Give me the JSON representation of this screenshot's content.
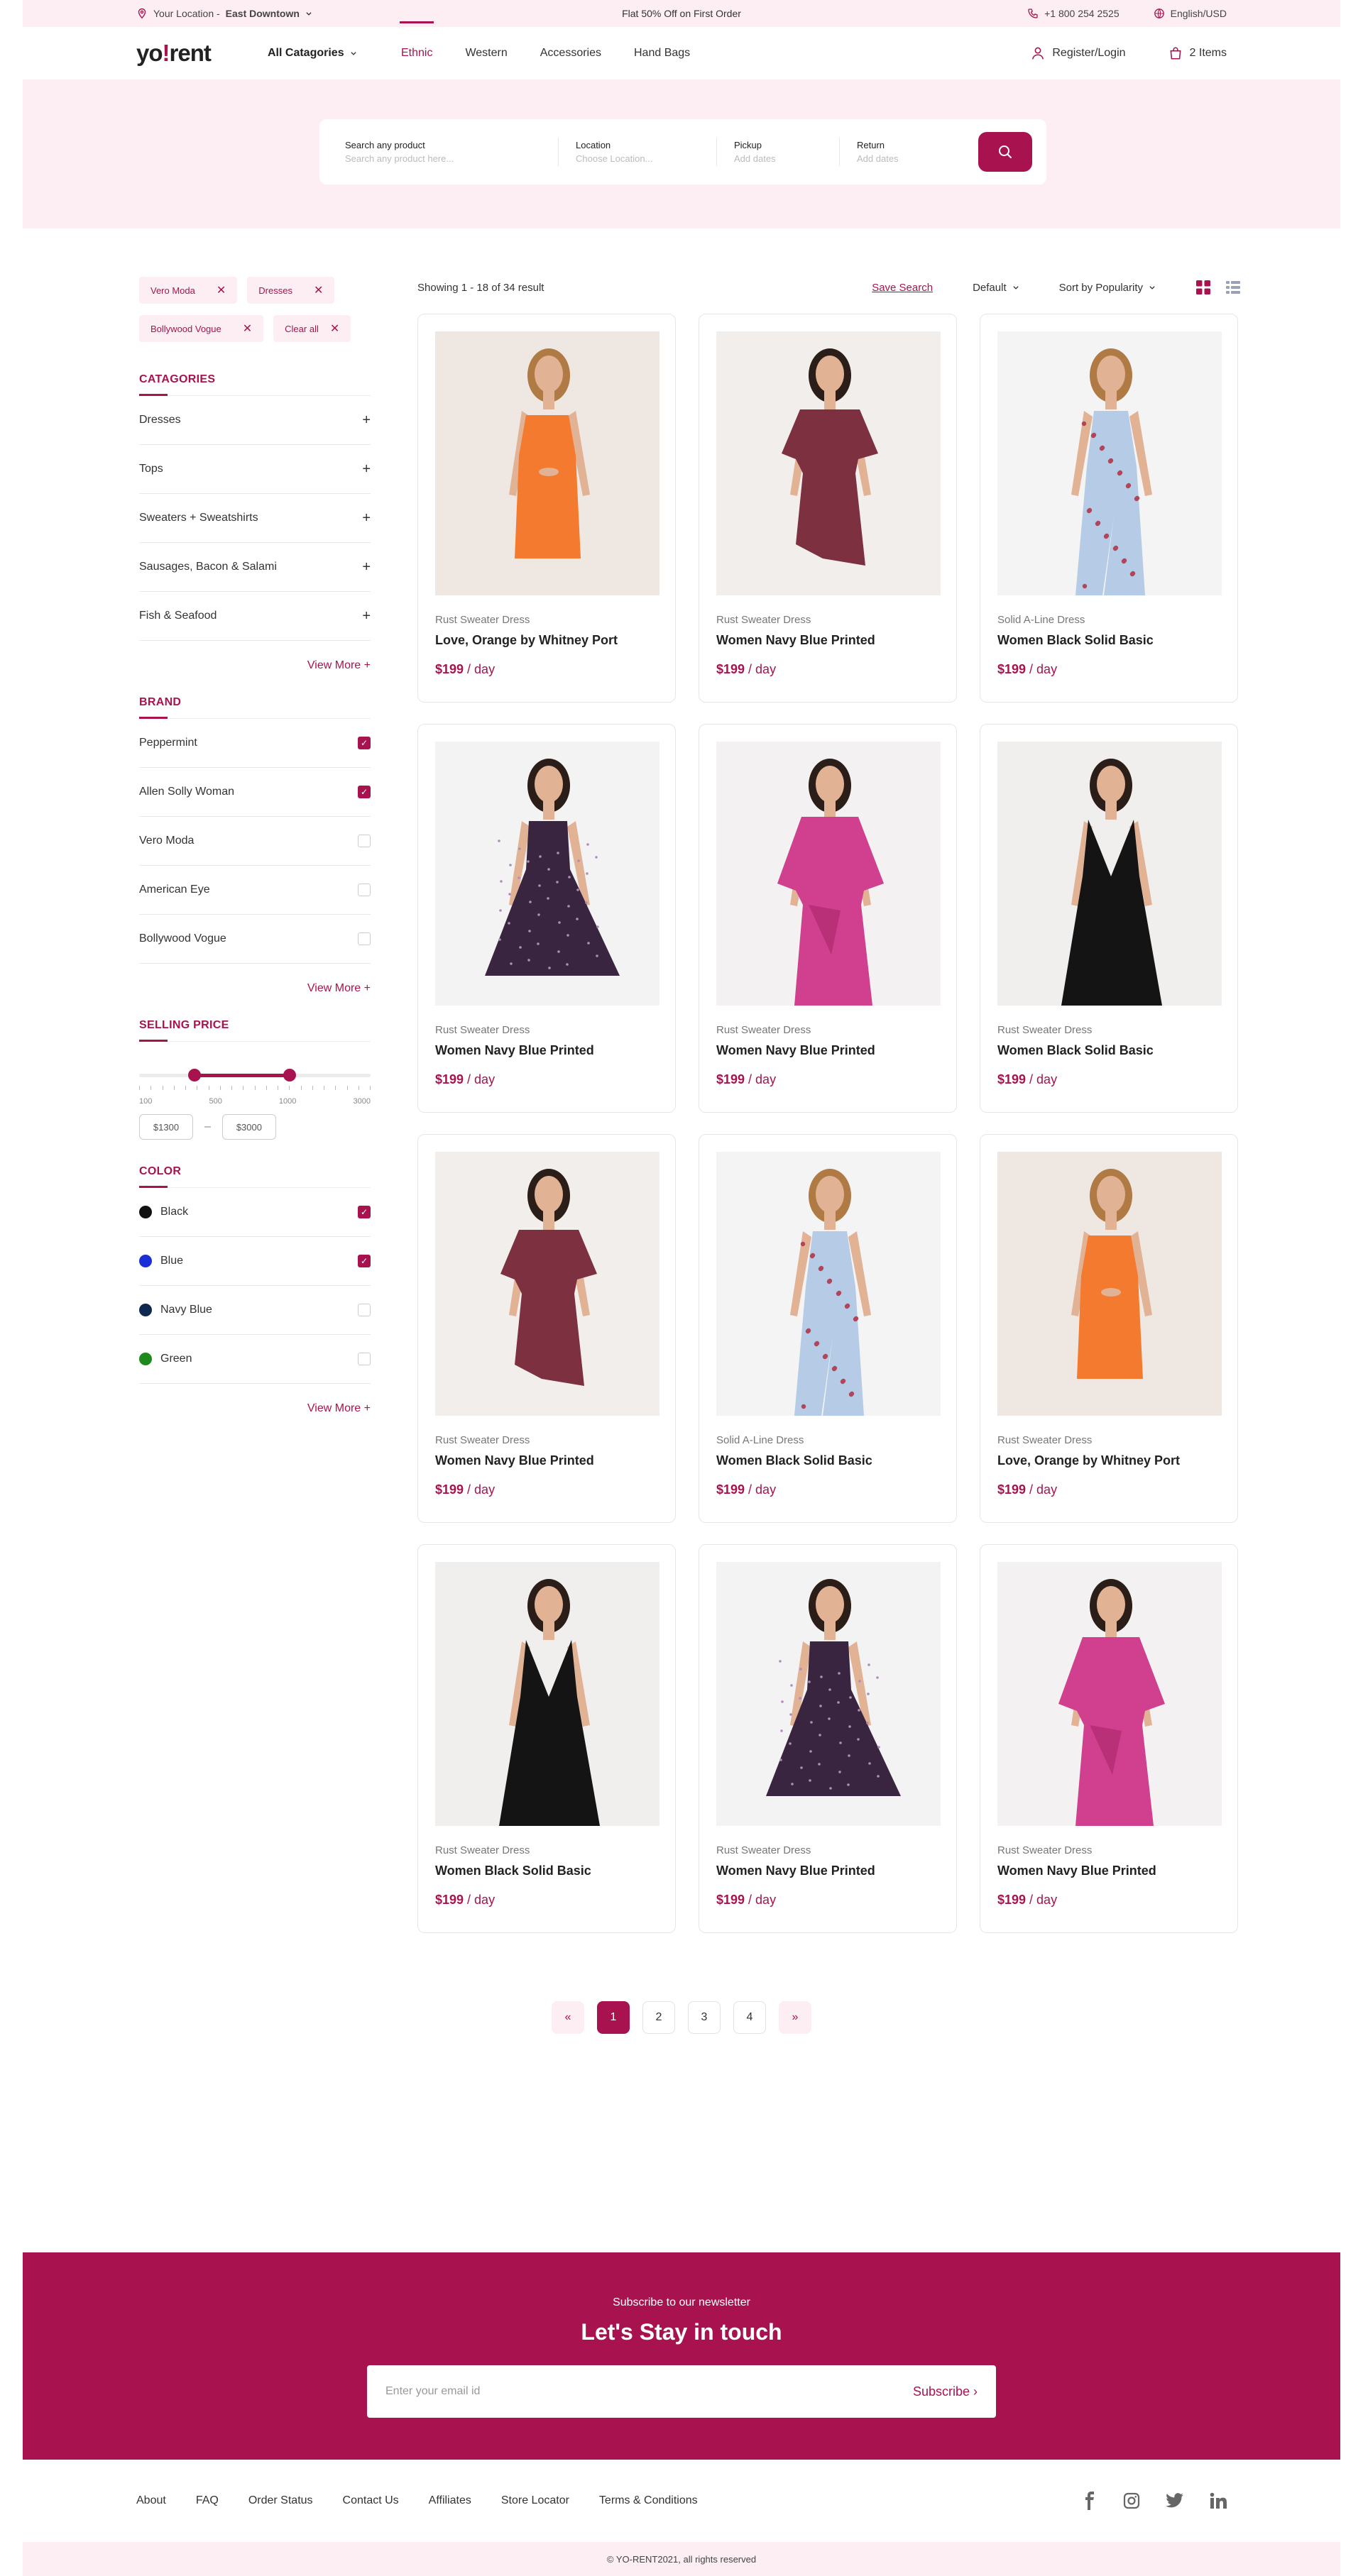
{
  "topbar": {
    "location_prefix": "Your Location - ",
    "location_value": "East Downtown",
    "promo": "Flat 50% Off on First Order",
    "phone": "+1 800 254 2525",
    "language": "English/USD"
  },
  "header": {
    "logo_main": "yo",
    "logo_accent": "!",
    "logo_rest": "rent",
    "all_categories": "All Catagories",
    "nav": [
      "Ethnic",
      "Western",
      "Accessories",
      "Hand Bags"
    ],
    "account": "Register/Login",
    "cart": "2 Items"
  },
  "search": {
    "product_label": "Search any product",
    "product_placeholder": "Search any product here...",
    "location_label": "Location",
    "location_placeholder": "Choose Location...",
    "pickup_label": "Pickup",
    "pickup_placeholder": "Add dates",
    "return_label": "Return",
    "return_placeholder": "Add dates"
  },
  "filters": {
    "chips": [
      "Vero Moda",
      "Dresses",
      "Bollywood Vogue",
      "Clear all"
    ],
    "categories_title": "CATAGORIES",
    "categories": [
      "Dresses",
      "Tops",
      "Sweaters + Sweatshirts",
      "Sausages, Bacon & Salami",
      "Fish & Seafood"
    ],
    "view_more": "View More",
    "brand_title": "BRAND",
    "brands": [
      {
        "name": "Peppermint",
        "checked": true
      },
      {
        "name": "Allen Solly Woman",
        "checked": true
      },
      {
        "name": "Vero Moda",
        "checked": false
      },
      {
        "name": "American Eye",
        "checked": false
      },
      {
        "name": "Bollywood Vogue",
        "checked": false
      }
    ],
    "price_title": "SELLING PRICE",
    "price_ticks": [
      "100",
      "500",
      "1000",
      "3000"
    ],
    "price_min": "$1300",
    "price_max": "$3000",
    "price_separator": "–",
    "price_range_fraction": [
      0.24,
      0.65
    ],
    "color_title": "COLOR",
    "colors": [
      {
        "name": "Black",
        "hex": "#111111",
        "checked": true
      },
      {
        "name": "Blue",
        "hex": "#1b2fd6",
        "checked": true
      },
      {
        "name": "Navy Blue",
        "hex": "#0f2850",
        "checked": false
      },
      {
        "name": "Green",
        "hex": "#1e8a1e",
        "checked": false
      }
    ]
  },
  "results": {
    "showing": "Showing 1 - 18 of 34 result",
    "save_search": "Save Search",
    "default_sort": "Default",
    "sort_by": "Sort by Popularity"
  },
  "products": [
    {
      "category": "Rust Sweater Dress",
      "name": "Love, Orange by Whitney Port",
      "price": "$199",
      "unit": " / day",
      "dress": "orange",
      "dress_color": "#f47a2f",
      "bg": "#efe7e1"
    },
    {
      "category": "Rust Sweater Dress",
      "name": "Women Navy Blue Printed",
      "price": "$199",
      "unit": " / day",
      "dress": "rust",
      "dress_color": "#7d3140",
      "bg": "#f1eeec"
    },
    {
      "category": "Solid A-Line Dress",
      "name": "Women Black Solid Basic",
      "price": "$199",
      "unit": " / day",
      "dress": "floral",
      "dress_color": "#b5cbe6",
      "bg": "#f4f4f4"
    },
    {
      "category": "Rust Sweater Dress",
      "name": "Women Navy Blue Printed",
      "price": "$199",
      "unit": " / day",
      "dress": "purple",
      "dress_color": "#3a2541",
      "bg": "#f3f3f3"
    },
    {
      "category": "Rust Sweater Dress",
      "name": "Women Navy Blue Printed",
      "price": "$199",
      "unit": " / day",
      "dress": "pink",
      "dress_color": "#d0408e",
      "bg": "#f3f1f1"
    },
    {
      "category": "Rust Sweater Dress",
      "name": "Women Black Solid Basic",
      "price": "$199",
      "unit": " / day",
      "dress": "black",
      "dress_color": "#141414",
      "bg": "#f1efee"
    },
    {
      "category": "Rust Sweater Dress",
      "name": "Women Navy Blue Printed",
      "price": "$199",
      "unit": " / day",
      "dress": "rust",
      "dress_color": "#7d3140",
      "bg": "#f1eeec"
    },
    {
      "category": "Solid A-Line Dress",
      "name": "Women Black Solid Basic",
      "price": "$199",
      "unit": " / day",
      "dress": "floral",
      "dress_color": "#b5cbe6",
      "bg": "#f4f4f4"
    },
    {
      "category": "Rust Sweater Dress",
      "name": "Love, Orange by Whitney Port",
      "price": "$199",
      "unit": " / day",
      "dress": "orange",
      "dress_color": "#f47a2f",
      "bg": "#efe7e1"
    },
    {
      "category": "Rust Sweater Dress",
      "name": "Women Black Solid Basic",
      "price": "$199",
      "unit": " / day",
      "dress": "black",
      "dress_color": "#141414",
      "bg": "#f1efee"
    },
    {
      "category": "Rust Sweater Dress",
      "name": "Women Navy Blue Printed",
      "price": "$199",
      "unit": " / day",
      "dress": "purple",
      "dress_color": "#3a2541",
      "bg": "#f3f3f3"
    },
    {
      "category": "Rust Sweater Dress",
      "name": "Women Navy Blue Printed",
      "price": "$199",
      "unit": " / day",
      "dress": "pink",
      "dress_color": "#d0408e",
      "bg": "#f3f1f1"
    }
  ],
  "pagination": {
    "prev": "«",
    "pages": [
      "1",
      "2",
      "3",
      "4"
    ],
    "next": "»",
    "current": "1"
  },
  "newsletter": {
    "subtitle": "Subscribe to our newsletter",
    "title": "Let's Stay in touch",
    "placeholder": "Enter your email id",
    "button": "Subscribe"
  },
  "footer": {
    "links": [
      "About",
      "FAQ",
      "Order Status",
      "Contact Us",
      "Affiliates",
      "Store Locator",
      "Terms & Conditions"
    ],
    "social": [
      "facebook-icon",
      "instagram-icon",
      "twitter-icon",
      "linkedin-icon"
    ],
    "copyright": "© YO-RENT2021, all rights reserved"
  },
  "colors": {
    "brand": "#a8134f",
    "tint": "#fdeef3"
  }
}
